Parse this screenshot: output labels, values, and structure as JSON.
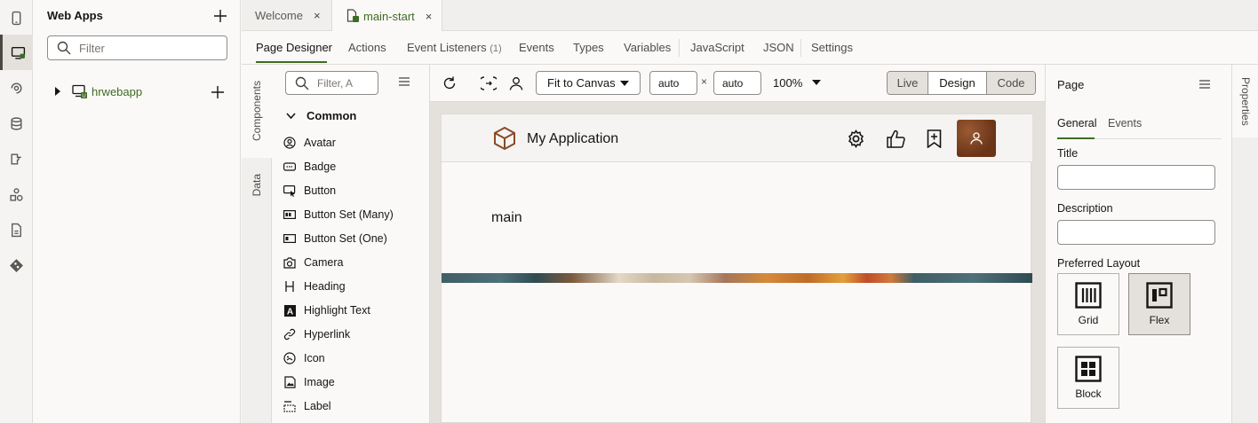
{
  "explorer": {
    "title": "Web Apps",
    "filter_placeholder": "Filter",
    "tree": [
      {
        "label": "hrwebapp"
      }
    ]
  },
  "tabs": [
    {
      "label": "Welcome",
      "close": "×"
    },
    {
      "label": "main-start",
      "close": "×"
    }
  ],
  "subtabs": {
    "page_designer": "Page Designer",
    "actions": "Actions",
    "event_listeners": "Event Listeners",
    "event_listeners_count": "(1)",
    "events": "Events",
    "types": "Types",
    "variables": "Variables",
    "javascript": "JavaScript",
    "json": "JSON",
    "settings": "Settings"
  },
  "side_tabs": {
    "components": "Components",
    "data": "Data"
  },
  "palette": {
    "filter_placeholder": "Filter, A",
    "section": "Common",
    "items": [
      "Avatar",
      "Badge",
      "Button",
      "Button Set (Many)",
      "Button Set (One)",
      "Camera",
      "Heading",
      "Highlight Text",
      "Hyperlink",
      "Icon",
      "Image",
      "Label"
    ]
  },
  "toolbar": {
    "fit_option": "Fit to Canvas",
    "width": "auto",
    "times": "×",
    "height": "auto",
    "zoom": "100%",
    "modes": [
      "Live",
      "Design",
      "Code"
    ],
    "active_mode": "Design"
  },
  "canvas": {
    "app_title": "My Application",
    "main_label": "main"
  },
  "properties": {
    "title": "Page",
    "tabs": [
      "General",
      "Events"
    ],
    "title_label": "Title",
    "title_value": "",
    "description_label": "Description",
    "description_value": "",
    "layout_label": "Preferred Layout",
    "layouts": [
      "Grid",
      "Flex",
      "Block"
    ],
    "selected_layout": "Flex",
    "rail_label": "Properties"
  },
  "colors": {
    "accent_green": "#3e6c23",
    "avatar_brown": "#8b4a26"
  }
}
